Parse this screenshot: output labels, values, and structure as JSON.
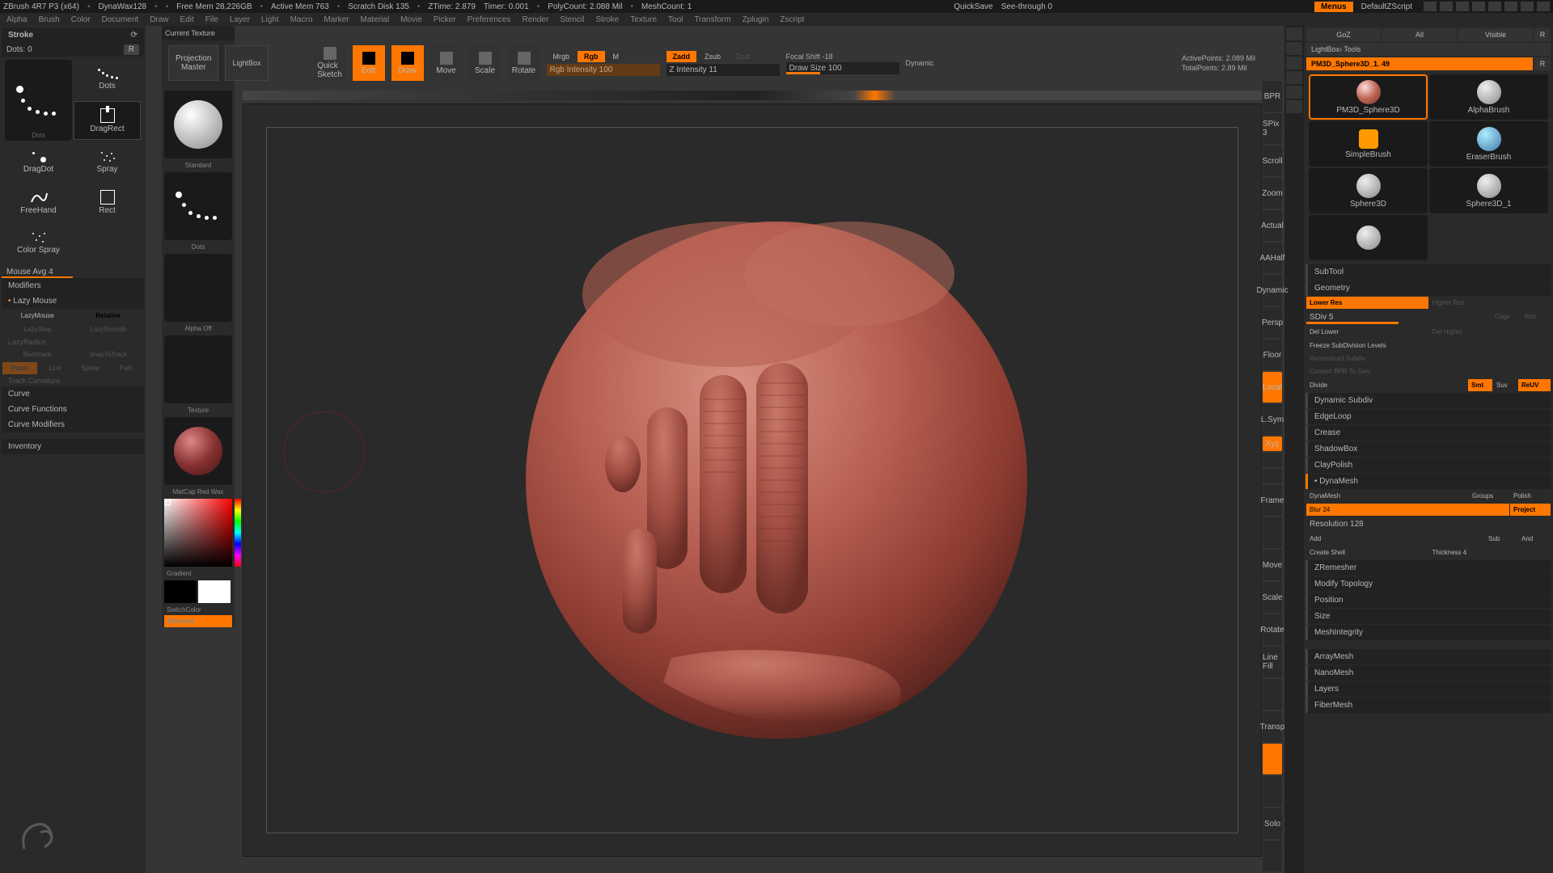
{
  "title_bar": {
    "app": "ZBrush 4R7 P3 (x64)",
    "project": "DynaWax128",
    "free_mem": "Free Mem 28,226GB",
    "active_mem": "Active Mem 763",
    "scratch": "Scratch Disk 135",
    "ztime": "ZTime: 2.879",
    "timer": "Timer: 0.001",
    "polycount": "PolyCount: 2.088 Mil",
    "meshcount": "MeshCount: 1",
    "quicksave": "QuickSave",
    "seethrough": "See-through  0",
    "menus": "Menus",
    "default_z": "DefaultZScript"
  },
  "menu": [
    "Alpha",
    "Brush",
    "Color",
    "Document",
    "Draw",
    "Edit",
    "File",
    "Layer",
    "Light",
    "Macro",
    "Marker",
    "Material",
    "Movie",
    "Picker",
    "Preferences",
    "Render",
    "Stencil",
    "Stroke",
    "Texture",
    "Tool",
    "Transform",
    "Zplugin",
    "Zscript"
  ],
  "stroke_panel": {
    "title": "Stroke",
    "dots_label": "Dots: 0",
    "r_btn": "R",
    "grid": {
      "big": "Dots",
      "items": [
        "Dots",
        "DragRect",
        "DragDot",
        "Spray",
        "FreeHand",
        "Rect",
        "Color Spray"
      ]
    },
    "mouse_avg": "Mouse Avg 4",
    "modifiers": "Modifiers",
    "lazy_mouse": "Lazy Mouse",
    "lazymouse_btn": "LazyMouse",
    "relative_btn": "Relative",
    "lazystep": "LazyStep",
    "lazysmooth": "LazySmooth",
    "lazyradius": "LazyRadius",
    "backtrack": "Backtrack",
    "snaptotrack": "SnapToTrack",
    "plane": "Plane",
    "line": "Line",
    "spline": "Spline",
    "path": "Path",
    "track": "Track Curvature",
    "curve": "Curve",
    "curve_func": "Curve Functions",
    "curve_mod": "Curve Modifiers",
    "inventory": "Inventory"
  },
  "texture_panel": {
    "header": "Current Texture",
    "standard": "Standard",
    "dots": "Dots",
    "alpha_off": "Alpha Off",
    "texture": "Texture",
    "matcap": "MatCap Red Wax",
    "gradient": "Gradient",
    "switchcolor": "SwitchColor",
    "alternate": "Alternate"
  },
  "top_shelf": {
    "projection": "Projection\nMaster",
    "lightbox": "LightBox",
    "quicksketch": "Quick\nSketch",
    "edit": "Edit",
    "draw": "Draw",
    "move": "Move",
    "scale": "Scale",
    "rotate": "Rotate",
    "mrgb": "Mrgb",
    "rgb": "Rgb",
    "m": "M",
    "rgb_int": "Rgb Intensity 100",
    "zadd": "Zadd",
    "zsub": "Zsub",
    "zcut": "Zcut",
    "z_int": "Z Intensity 11",
    "focal": "Focal Shift -18",
    "draw_size": "Draw Size 100",
    "dynamic": "Dynamic",
    "activepoints": "ActivePoints: 2.089 Mil",
    "totalpoints": "TotalPoints: 2.89 Mil"
  },
  "right_shelf": [
    "BPR",
    "SPix 3",
    "Scroll",
    "Zoom",
    "Actual",
    "AAHalf",
    "Dynamic",
    "Persp",
    "Floor",
    "Local",
    "L.Sym",
    "Xyz",
    "",
    "",
    "Frame",
    "",
    "Move",
    "Scale",
    "Rotate",
    "Line Fill",
    "",
    "Transp",
    "",
    "",
    "Solo",
    ""
  ],
  "right_panel": {
    "top_row": [
      "GoZ",
      "All",
      "Visible",
      "R"
    ],
    "lightbox": "LightBox› Tools",
    "tool_name": "PM3D_Sphere3D_1. 49",
    "r": "R",
    "tools": [
      "PM3D_Sphere3D",
      "AlphaBrush",
      "SimpleBrush",
      "EraserBrush",
      "Sphere3D",
      "Sphere3D_1",
      ""
    ],
    "subtool": "SubTool",
    "geometry": "Geometry",
    "lower_res": "Lower Res",
    "higher_res": "Higher Res",
    "sdiv": "SDiv 5",
    "cage": "Cage",
    "rstr": "Rstr",
    "del_lower": "Del Lower",
    "del_higher": "Del Higher",
    "freeze": "Freeze SubDivision Levels",
    "reconstruct": "Reconstruct Subdiv",
    "convert": "Convert BPR To Geo",
    "divide": "Divide",
    "smt": "Smt",
    "suv": "Suv",
    "reuv": "ReUV",
    "dynamic_subdiv": "Dynamic Subdiv",
    "edgeloop": "EdgeLoop",
    "crease": "Crease",
    "shadowbox": "ShadowBox",
    "claypolish": "ClayPolish",
    "dynamesh": "DynaMesh",
    "dynamesh_btn": "DynaMesh",
    "groups": "Groups",
    "polish": "Polish",
    "blur": "Blur 24",
    "project": "Project",
    "resolution": "Resolution 128",
    "add": "Add",
    "sub": "Sub",
    "and": "And",
    "create_shell": "Create Shell",
    "thickness": "Thickness 4",
    "zremesher": "ZRemesher",
    "modify_topo": "Modify Topology",
    "position": "Position",
    "size": "Size",
    "meshintegrity": "MeshIntegrity",
    "arraymesh": "ArrayMesh",
    "nanomesh": "NanoMesh",
    "layers": "Layers",
    "fibermesh": "FiberMesh"
  }
}
